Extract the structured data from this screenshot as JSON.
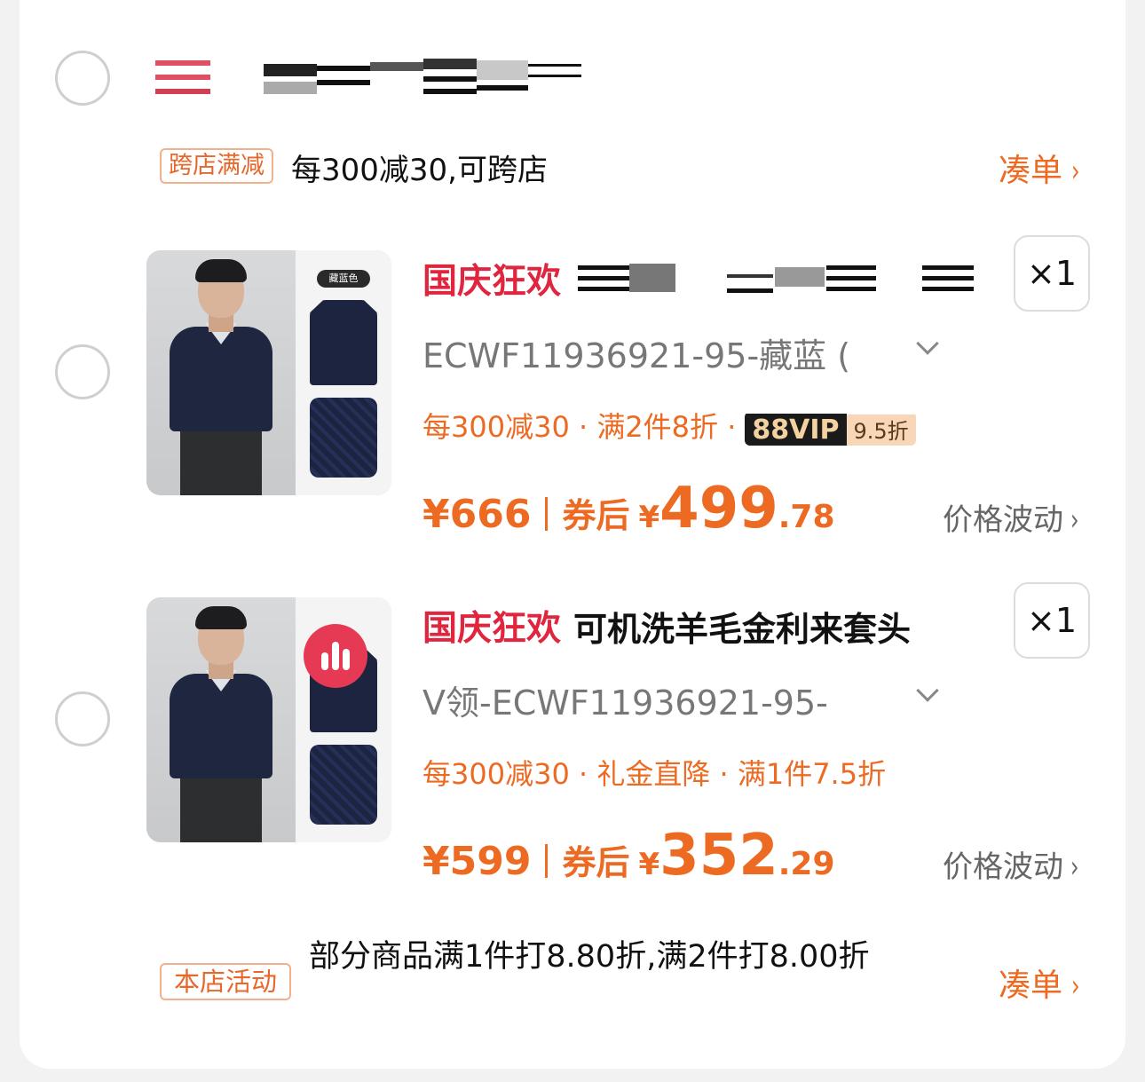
{
  "store": {
    "cross_store_tag": "跨店满减",
    "cross_store_text": "每300减30,可跨店",
    "collect_label": "凑单",
    "chevron": "›"
  },
  "products": [
    {
      "festival_tag": "国庆狂欢",
      "title": "",
      "title_redacted": true,
      "quantity": "×1",
      "sku": "ECWF11936921-95-藏蓝 (",
      "swatch_label": "藏蓝色",
      "promos": "每300减30 · 满2件8折 ·",
      "vip_label": "88VIP",
      "vip_discount": "9.5折",
      "orig_price": "¥666",
      "after_label": "券后",
      "currency": "¥",
      "price_int": "499",
      "price_dec": ".78",
      "fluct_label": "价格波动",
      "chevron": "›"
    },
    {
      "festival_tag": "国庆狂欢",
      "title": "可机洗羊毛金利来套头",
      "title_redacted": false,
      "quantity": "×1",
      "sku": "V领-ECWF11936921-95-",
      "promos": "每300减30 · 礼金直降 · 满1件7.5折",
      "orig_price": "¥599",
      "after_label": "券后",
      "currency": "¥",
      "price_int": "352",
      "price_dec": ".29",
      "fluct_label": "价格波动",
      "chevron": "›"
    }
  ],
  "store_activity": {
    "tag": "本店活动",
    "text": "部分商品满1件打8.80折,满2件打8.00折",
    "collect_label": "凑单",
    "chevron": "›"
  },
  "colors": {
    "accent": "#ec6a22",
    "festival": "#e0253f",
    "badge": "#e63a54"
  }
}
